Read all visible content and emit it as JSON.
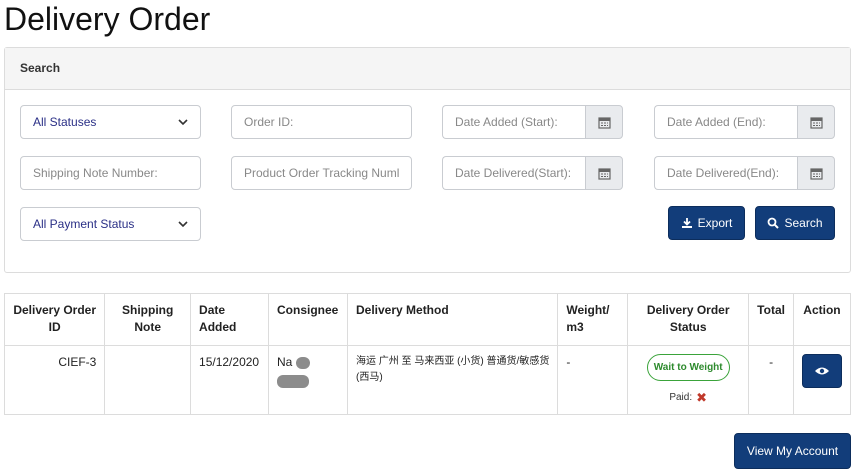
{
  "page": {
    "title": "Delivery Order"
  },
  "search": {
    "heading": "Search",
    "status_select": "All Statuses",
    "order_id_placeholder": "Order ID:",
    "date_added_start_placeholder": "Date Added (Start):",
    "date_added_end_placeholder": "Date Added (End):",
    "shipping_note_placeholder": "Shipping Note Number:",
    "tracking_placeholder": "Product Order Tracking Numl",
    "date_delivered_start_placeholder": "Date Delivered(Start):",
    "date_delivered_end_placeholder": "Date Delivered(End):",
    "payment_select": "All Payment Status",
    "export_label": "Export",
    "search_label": "Search"
  },
  "table": {
    "headers": {
      "delivery_order_id": "Delivery Order ID",
      "shipping_note": "Shipping Note",
      "date_added": "Date Added",
      "consignee": "Consignee",
      "delivery_method": "Delivery Method",
      "weight": "Weight/ m3",
      "status": "Delivery Order Status",
      "total": "Total",
      "action": "Action"
    },
    "rows": [
      {
        "delivery_order_id": "CIEF-3",
        "shipping_note": "",
        "date_added": "15/12/2020",
        "consignee": "Na",
        "delivery_method": "海运 广州 至 马来西亚 (小货) 普通货/敏感货 (西马)",
        "weight": "-",
        "status": "Wait to Weight",
        "paid_label": "Paid:",
        "total": "-"
      }
    ]
  },
  "footer": {
    "view_account_label": "View My Account"
  },
  "colors": {
    "primary": "#123d7a",
    "status_green": "#3aa33a",
    "unpaid_red": "#c0392b"
  }
}
